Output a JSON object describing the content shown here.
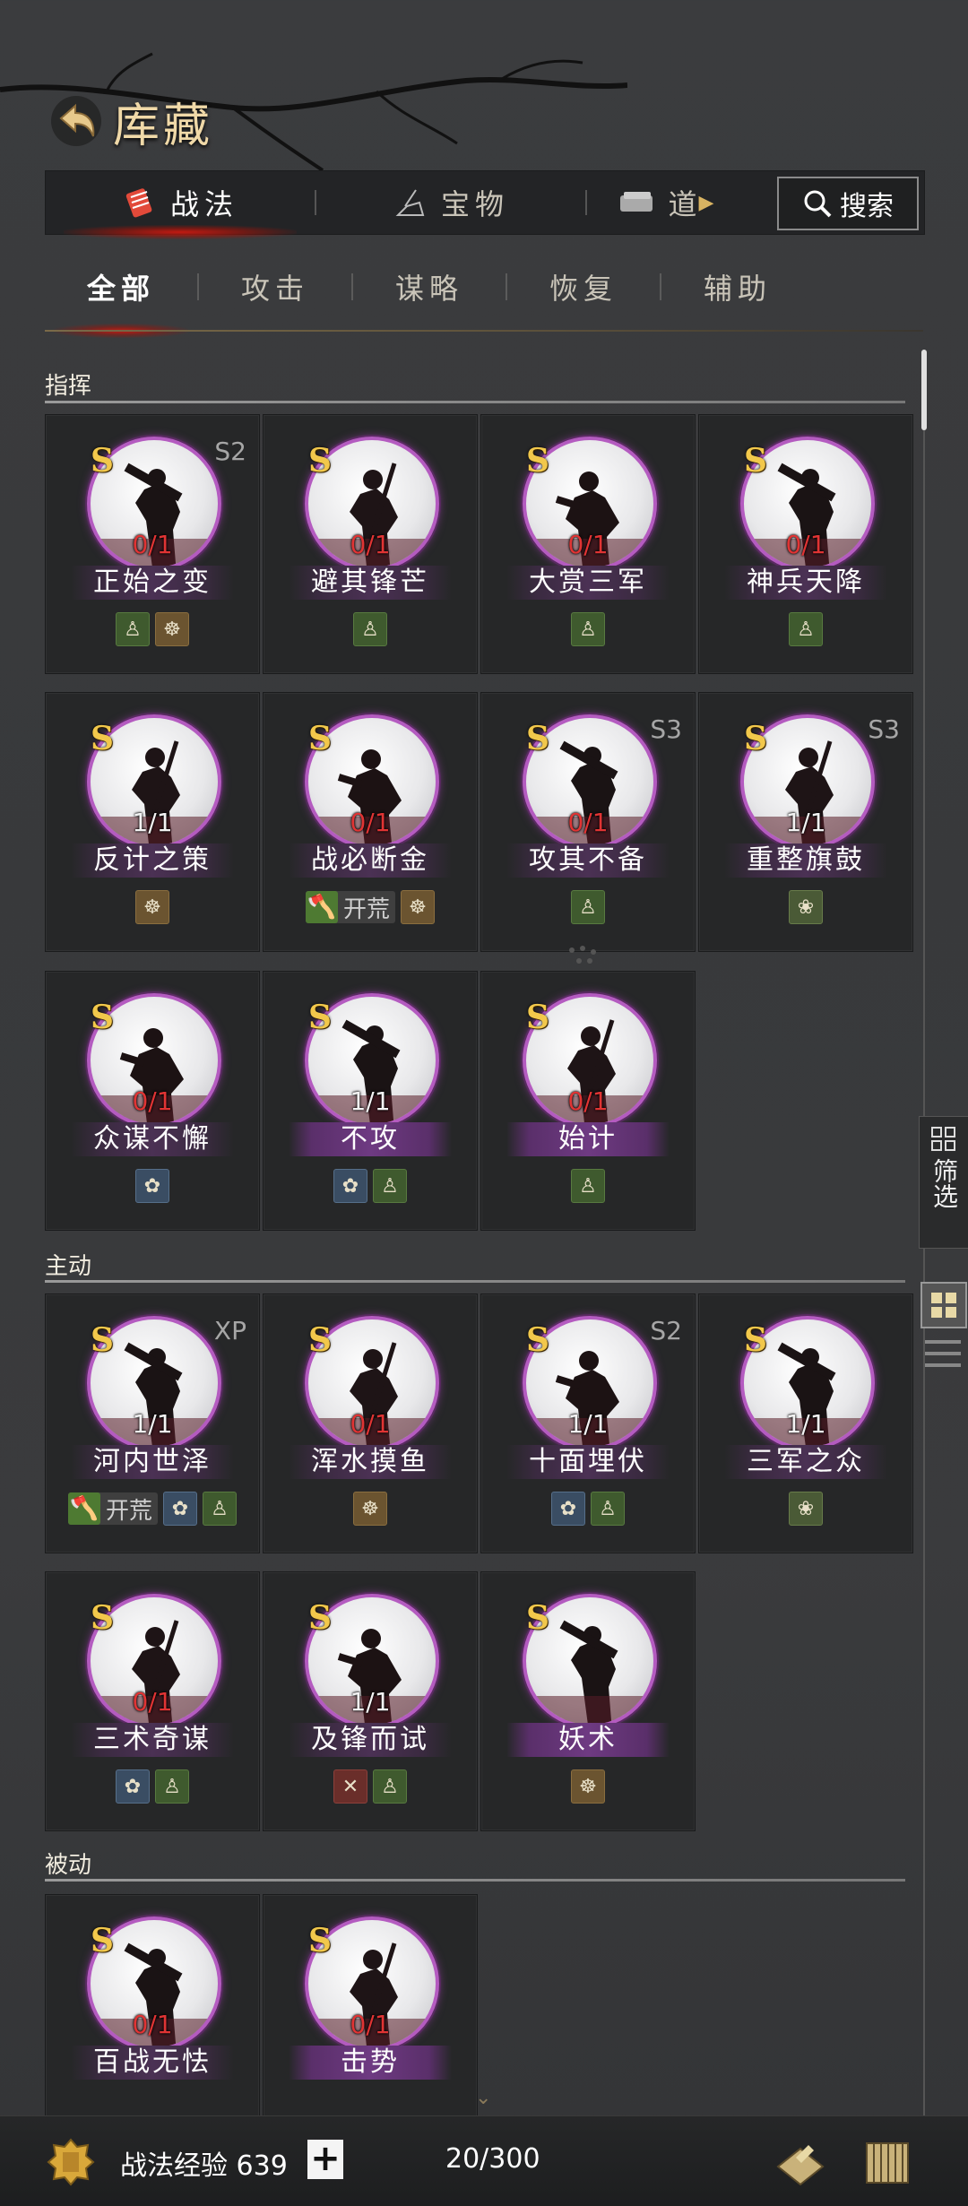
{
  "header": {
    "title": "库藏"
  },
  "main_tabs": [
    {
      "label": "战法",
      "icon": "tactic-scroll-icon",
      "active": true
    },
    {
      "label": "宝物",
      "icon": "treasure-icon",
      "active": false
    },
    {
      "label": "道",
      "icon": "item-icon",
      "active": false
    }
  ],
  "search": {
    "label": "搜索"
  },
  "sub_tabs": [
    {
      "label": "全部",
      "active": true
    },
    {
      "label": "攻击",
      "active": false
    },
    {
      "label": "谋略",
      "active": false
    },
    {
      "label": "恢复",
      "active": false
    },
    {
      "label": "辅助",
      "active": false
    }
  ],
  "sections": {
    "command": {
      "title": "指挥",
      "cards": [
        {
          "grade": "S",
          "season": "S2",
          "count": "0/1",
          "name": "正始之变",
          "tags": [
            "green",
            "brown"
          ]
        },
        {
          "grade": "S",
          "season": "",
          "count": "0/1",
          "name": "避其锋芒",
          "tags": [
            "green"
          ]
        },
        {
          "grade": "S",
          "season": "",
          "count": "0/1",
          "name": "大赏三军",
          "tags": [
            "green"
          ]
        },
        {
          "grade": "S",
          "season": "",
          "count": "0/1",
          "name": "神兵天降",
          "tags": [
            "green"
          ]
        },
        {
          "grade": "S",
          "season": "",
          "count": "1/1",
          "name": "反计之策",
          "tags": [
            "brown"
          ]
        },
        {
          "grade": "S",
          "season": "",
          "count": "0/1",
          "name": "战必断金",
          "kaihuang": "开荒",
          "tags": [
            "brown"
          ]
        },
        {
          "grade": "S",
          "season": "S3",
          "count": "0/1",
          "name": "攻其不备",
          "tags": [
            "green"
          ]
        },
        {
          "grade": "S",
          "season": "S3",
          "count": "1/1",
          "name": "重整旗鼓",
          "tags": [
            "teal"
          ]
        },
        {
          "grade": "S",
          "season": "",
          "count": "0/1",
          "name": "众谋不懈",
          "tags": [
            "blue"
          ]
        },
        {
          "grade": "S",
          "season": "",
          "count": "1/1",
          "name": "不攻",
          "tags": [
            "blue",
            "green"
          ],
          "purple": true
        },
        {
          "grade": "S",
          "season": "",
          "count": "0/1",
          "name": "始计",
          "tags": [
            "green"
          ],
          "purple": true
        }
      ]
    },
    "active": {
      "title": "主动",
      "cards": [
        {
          "grade": "S",
          "season": "XP",
          "count": "1/1",
          "name": "河内世泽",
          "kaihuang": "开荒",
          "tags": [
            "blue",
            "green"
          ]
        },
        {
          "grade": "S",
          "season": "",
          "count": "0/1",
          "name": "浑水摸鱼",
          "tags": [
            "brown"
          ]
        },
        {
          "grade": "S",
          "season": "S2",
          "count": "1/1",
          "name": "十面埋伏",
          "tags": [
            "blue",
            "green"
          ]
        },
        {
          "grade": "S",
          "season": "",
          "count": "1/1",
          "name": "三军之众",
          "tags": [
            "teal"
          ]
        },
        {
          "grade": "S",
          "season": "",
          "count": "0/1",
          "name": "三术奇谋",
          "tags": [
            "blue",
            "green"
          ]
        },
        {
          "grade": "S",
          "season": "",
          "count": "1/1",
          "name": "及锋而试",
          "tags": [
            "red",
            "green"
          ]
        },
        {
          "grade": "S",
          "season": "",
          "count": "",
          "name": "妖术",
          "tags": [
            "brown"
          ],
          "purple": true
        }
      ]
    },
    "passive": {
      "title": "被动",
      "cards": [
        {
          "grade": "S",
          "season": "",
          "count": "0/1",
          "name": "百战无怯",
          "tags": []
        },
        {
          "grade": "S",
          "season": "",
          "count": "0/1",
          "name": "击势",
          "tags": [],
          "purple": true
        }
      ]
    }
  },
  "side": {
    "filter_label": "筛选"
  },
  "bottom": {
    "exp_label": "战法经验 639",
    "plus": "+",
    "capacity": "20/300"
  },
  "colors": {
    "accent_red": "#c21a12",
    "grade_gold": "#f2c84b",
    "count_red": "#e03434",
    "frame_purple": "#b45bc0"
  }
}
